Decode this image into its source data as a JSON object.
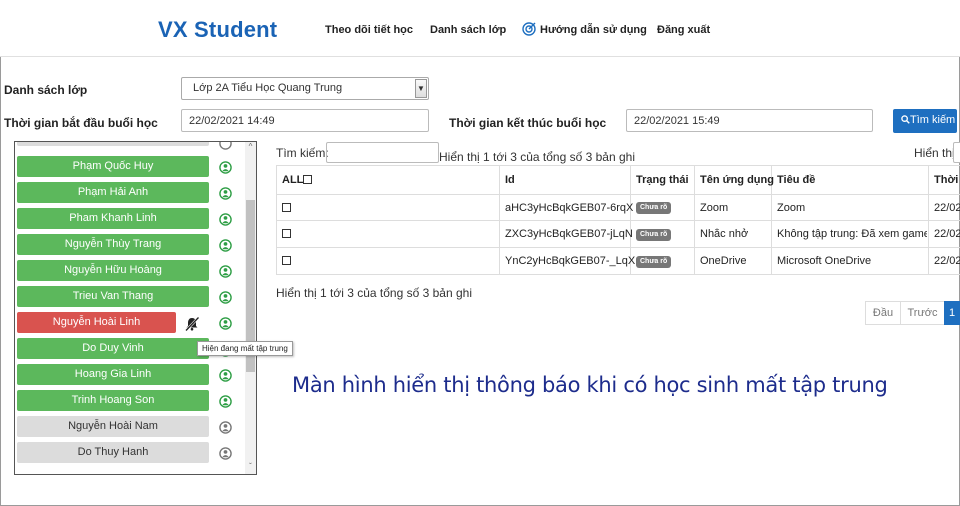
{
  "header": {
    "brand": "VX Student",
    "nav": [
      "Theo dõi tiết học",
      "Danh sách lớp",
      "Hướng dẫn sử dụng",
      "Đăng xuất"
    ]
  },
  "filters": {
    "class_label": "Danh sách lớp",
    "class_value": "Lớp 2A Tiểu Học Quang Trung",
    "start_label": "Thời gian bắt đầu buổi học",
    "start_value": "22/02/2021 14:49",
    "end_label": "Thời gian kết thúc buổi học",
    "end_value": "22/02/2021 15:49",
    "search_button": "Tìm kiếm"
  },
  "students": [
    {
      "name": "Phạm Quốc Huy",
      "status": "online"
    },
    {
      "name": "Phạm Hải Anh",
      "status": "online"
    },
    {
      "name": "Pham Khanh Linh",
      "status": "online"
    },
    {
      "name": "Nguyễn Thùy Trang",
      "status": "online"
    },
    {
      "name": "Nguyễn Hữu Hoàng",
      "status": "online"
    },
    {
      "name": "Trieu Van Thang",
      "status": "online"
    },
    {
      "name": "Nguyễn Hoài Linh",
      "status": "distracted"
    },
    {
      "name": "Do Duy Vinh",
      "status": "online"
    },
    {
      "name": "Hoang Gia Linh",
      "status": "online"
    },
    {
      "name": "Trinh Hoang Son",
      "status": "online"
    },
    {
      "name": "Nguyễn Hoài Nam",
      "status": "offline"
    },
    {
      "name": "Do Thuy Hanh",
      "status": "offline"
    }
  ],
  "tooltip": "Hiện đang mất tập trung",
  "table": {
    "search_label": "Tìm kiếm:",
    "info_top": "Hiển thị 1 tới 3 của tổng số 3 bản ghi",
    "show_label": "Hiển thị",
    "columns": [
      "ALL",
      "Id",
      "Trạng thái",
      "Tên ứng dụng",
      "Tiêu đề",
      "Thời"
    ],
    "rows": [
      {
        "id": "aHC3yHcBqkGEB07-6rqX",
        "status": "Chưa rõ",
        "app": "Zoom",
        "title": "Zoom",
        "time": "22/02"
      },
      {
        "id": "ZXC3yHcBqkGEB07-jLqN",
        "status": "Chưa rõ",
        "app": "Nhắc nhở",
        "title": "Không tập trung: Đã xem game",
        "time": "22/02"
      },
      {
        "id": "YnC2yHcBqkGEB07-_LqX",
        "status": "Chưa rõ",
        "app": "OneDrive",
        "title": "Microsoft OneDrive",
        "time": "22/02"
      }
    ],
    "info_bottom": "Hiển thị 1 tới 3 của tổng số 3 bản ghi"
  },
  "pagination": {
    "first": "Đầu",
    "prev": "Trước",
    "current": "1"
  },
  "caption": "Màn hình hiển thị thông báo khi có học sinh mất tập trung",
  "colors": {
    "brand": "#1a63b5",
    "online": "#5cb85c",
    "distracted": "#d9534f",
    "offline": "#dcdcdc",
    "caption": "#1d2c8c"
  }
}
